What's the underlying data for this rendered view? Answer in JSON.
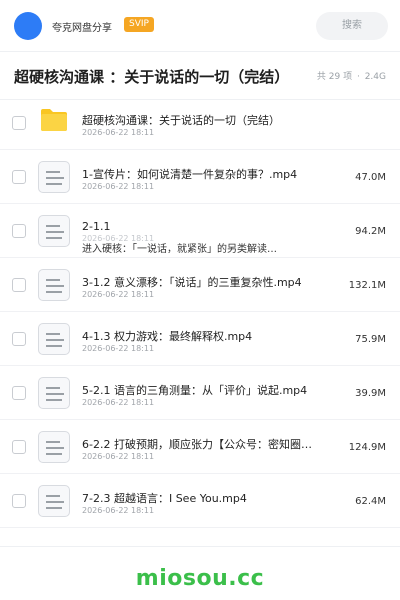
{
  "header": {
    "sharer_name": "夸克网盘分享",
    "badge": "SVIP",
    "search_placeholder": "搜索",
    "accent_color": "#2d7cf6",
    "badge_color": "#f5a623"
  },
  "folder": {
    "title": "超硬核沟通课 ：关于说话的一切（完结）",
    "count": "共 29 项",
    "separator": "·",
    "total_size": "2.4G"
  },
  "items": [
    {
      "icon": "folder-icon",
      "name": "超硬核沟通课：关于说话的一切（完结）",
      "date": "2026-06-22 18:11",
      "size": ""
    },
    {
      "icon": "document-icon",
      "name": "1-宣传片：如何说清楚一件复杂的事？.mp4",
      "date": "2026-06-22 18:11",
      "size": "47.0M"
    },
    {
      "icon": "document-icon",
      "name": "2-1.1",
      "name_line2": "进入硬核：「一说话，就紧张」的另类解读…",
      "date": "2026-06-22 18:11",
      "size": "94.2M"
    },
    {
      "icon": "document-icon",
      "name": "3-1.2 意义漂移：「说话」的三重复杂性.mp4",
      "date": "2026-06-22 18:11",
      "size": "132.1M"
    },
    {
      "icon": "document-icon",
      "name": "4-1.3 权力游戏：最终解释权.mp4",
      "date": "2026-06-22 18:11",
      "size": "75.9M"
    },
    {
      "icon": "document-icon",
      "name": "5-2.1 语言的三角测量：从「评价」说起.mp4",
      "date": "2026-06-22 18:11",
      "size": "39.9M"
    },
    {
      "icon": "document-icon",
      "name": "6-2.2 打破预期，顺应张力【公众号：密知圈】.…",
      "date": "2026-06-22 18:11",
      "size": "124.9M"
    },
    {
      "icon": "document-icon",
      "name": "7-2.3 超越语言：I See You.mp4",
      "date": "2026-06-22 18:11",
      "size": "62.4M"
    }
  ],
  "watermark": "miosou.cc",
  "watermark_color": "#3bbf4a"
}
